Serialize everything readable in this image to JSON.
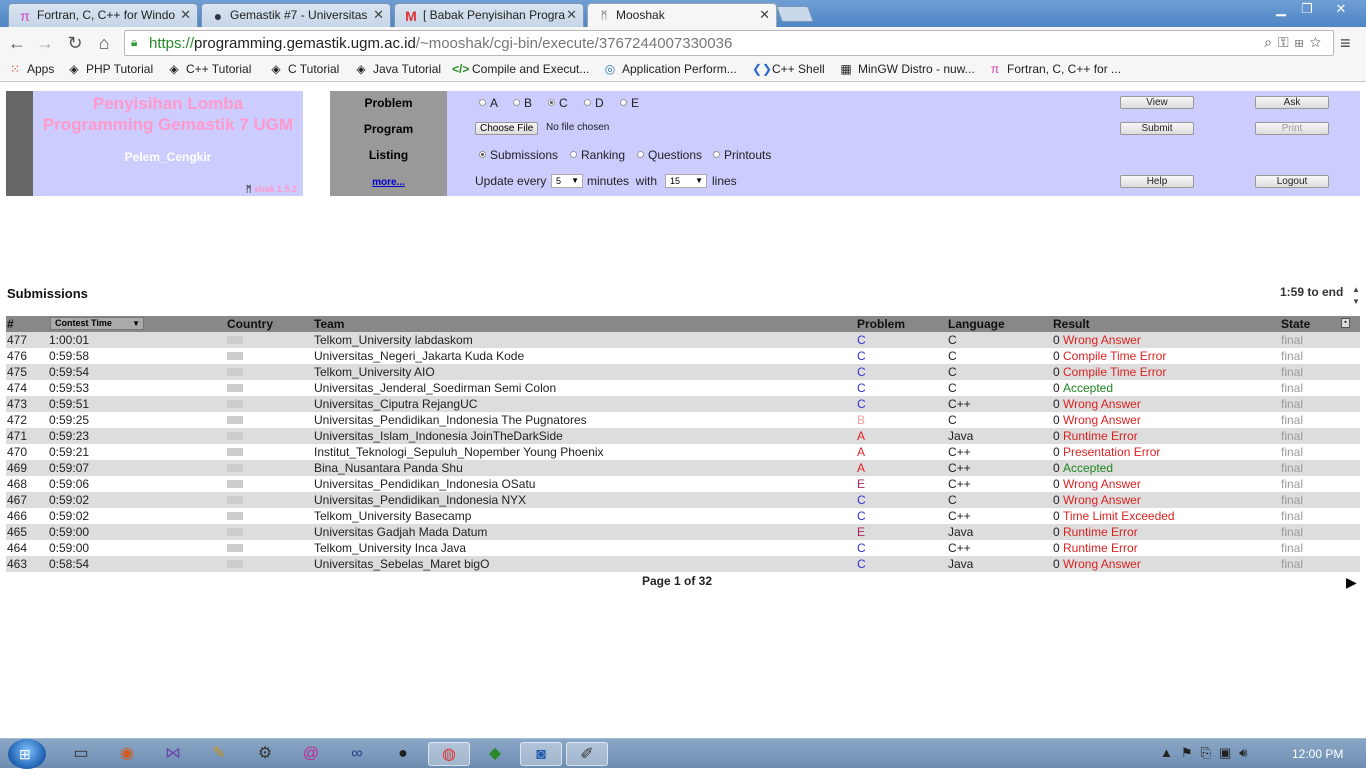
{
  "browser": {
    "tabs": [
      {
        "title": "Fortran, C, C++ for Windo",
        "icon": "pi-icon"
      },
      {
        "title": "Gemastik #7 - Universitas",
        "icon": "globe-icon"
      },
      {
        "title": "[ Babak Penyisihan Progra",
        "icon": "gmail-icon"
      },
      {
        "title": "Mooshak",
        "icon": "mooshak-icon",
        "active": true
      }
    ],
    "url_scheme": "https://",
    "url_host": "programming.gemastik.ugm.ac.id",
    "url_path": "/~mooshak/cgi-bin/execute/3767244007330036",
    "bookmarks": [
      {
        "label": "Apps",
        "icon": "apps-grid-icon"
      },
      {
        "label": "PHP Tutorial",
        "icon": "diamond-icon"
      },
      {
        "label": "C++ Tutorial",
        "icon": "diamond-icon"
      },
      {
        "label": "C Tutorial",
        "icon": "diamond-icon"
      },
      {
        "label": "Java Tutorial",
        "icon": "diamond-icon"
      },
      {
        "label": "Compile and Execut...",
        "icon": "code-icon"
      },
      {
        "label": "Application Perform...",
        "icon": "ring-icon"
      },
      {
        "label": "C++ Shell",
        "icon": "arrows-icon"
      },
      {
        "label": "MinGW Distro - nuw...",
        "icon": "grid-icon"
      },
      {
        "label": "Fortran, C, C++ for ...",
        "icon": "pi-icon"
      }
    ]
  },
  "logo": {
    "title_line1": "Penyisihan Lomba",
    "title_line2": "Programming Gemastik 7 UGM",
    "team": "Pelem_Cengkir",
    "version": "shak 1.5.2"
  },
  "controls": {
    "problem_label": "Problem",
    "program_label": "Program",
    "listing_label": "Listing",
    "more_label": "more...",
    "problems": [
      "A",
      "B",
      "C",
      "D",
      "E"
    ],
    "selected_problem": "C",
    "choose_file": "Choose File",
    "no_file": "No file chosen",
    "listings": [
      "Submissions",
      "Ranking",
      "Questions",
      "Printouts"
    ],
    "selected_listing": "Submissions",
    "update_every": "Update every",
    "update_value": "5",
    "minutes_with": "minutes  with",
    "lines_value": "15",
    "lines": "lines",
    "buttons": {
      "view": "View",
      "ask": "Ask",
      "submit": "Submit",
      "print": "Print",
      "help": "Help",
      "logout": "Logout"
    }
  },
  "submissions": {
    "title": "Submissions",
    "time_to_end": "1:59 to end",
    "columns": [
      "#",
      "Contest Time",
      "Country",
      "Team",
      "Problem",
      "Language",
      "Result",
      "State"
    ],
    "rows": [
      {
        "id": "477",
        "time": "1:00:01",
        "team": "Telkom_University labdaskom",
        "problem": "C",
        "pcolor": "#3333cc",
        "lang": "C",
        "score": "0",
        "result": "Wrong Answer",
        "rcolor": "#dd2222",
        "state": "final"
      },
      {
        "id": "476",
        "time": "0:59:58",
        "team": "Universitas_Negeri_Jakarta Kuda Kode",
        "problem": "C",
        "pcolor": "#3333cc",
        "lang": "C",
        "score": "0",
        "result": "Compile Time Error",
        "rcolor": "#dd2222",
        "state": "final"
      },
      {
        "id": "475",
        "time": "0:59:54",
        "team": "Telkom_University AIO",
        "problem": "C",
        "pcolor": "#3333cc",
        "lang": "C",
        "score": "0",
        "result": "Compile Time Error",
        "rcolor": "#dd2222",
        "state": "final"
      },
      {
        "id": "474",
        "time": "0:59:53",
        "team": "Universitas_Jenderal_Soedirman Semi Colon",
        "problem": "C",
        "pcolor": "#3333cc",
        "lang": "C",
        "score": "0",
        "result": "Accepted",
        "rcolor": "#228822",
        "state": "final"
      },
      {
        "id": "473",
        "time": "0:59:51",
        "team": "Universitas_Ciputra RejangUC",
        "problem": "C",
        "pcolor": "#3333cc",
        "lang": "C++",
        "score": "0",
        "result": "Wrong Answer",
        "rcolor": "#dd2222",
        "state": "final"
      },
      {
        "id": "472",
        "time": "0:59:25",
        "team": "Universitas_Pendidikan_Indonesia The Pugnatores",
        "problem": "B",
        "pcolor": "#f2a0a0",
        "lang": "C",
        "score": "0",
        "result": "Wrong Answer",
        "rcolor": "#dd2222",
        "state": "final"
      },
      {
        "id": "471",
        "time": "0:59:23",
        "team": "Universitas_Islam_Indonesia JoinTheDarkSide",
        "problem": "A",
        "pcolor": "#dd2222",
        "lang": "Java",
        "score": "0",
        "result": "Runtime Error",
        "rcolor": "#dd2222",
        "state": "final"
      },
      {
        "id": "470",
        "time": "0:59:21",
        "team": "Institut_Teknologi_Sepuluh_Nopember Young Phoenix",
        "problem": "A",
        "pcolor": "#dd2222",
        "lang": "C++",
        "score": "0",
        "result": "Presentation Error",
        "rcolor": "#dd2222",
        "state": "final"
      },
      {
        "id": "469",
        "time": "0:59:07",
        "team": "Bina_Nusantara Panda Shu",
        "problem": "A",
        "pcolor": "#dd2222",
        "lang": "C++",
        "score": "0",
        "result": "Accepted",
        "rcolor": "#228822",
        "state": "final"
      },
      {
        "id": "468",
        "time": "0:59:06",
        "team": "Universitas_Pendidikan_Indonesia OSatu",
        "problem": "E",
        "pcolor": "#aa2266",
        "lang": "C++",
        "score": "0",
        "result": "Wrong Answer",
        "rcolor": "#dd2222",
        "state": "final"
      },
      {
        "id": "467",
        "time": "0:59:02",
        "team": "Universitas_Pendidikan_Indonesia NYX",
        "problem": "C",
        "pcolor": "#3333cc",
        "lang": "C",
        "score": "0",
        "result": "Wrong Answer",
        "rcolor": "#dd2222",
        "state": "final"
      },
      {
        "id": "466",
        "time": "0:59:02",
        "team": "Telkom_University Basecamp",
        "problem": "C",
        "pcolor": "#3333cc",
        "lang": "C++",
        "score": "0",
        "result": "Time Limit Exceeded",
        "rcolor": "#dd2222",
        "state": "final"
      },
      {
        "id": "465",
        "time": "0:59:00",
        "team": "Universitas Gadjah Mada Datum",
        "problem": "E",
        "pcolor": "#aa2266",
        "lang": "Java",
        "score": "0",
        "result": "Runtime Error",
        "rcolor": "#dd2222",
        "state": "final"
      },
      {
        "id": "464",
        "time": "0:59:00",
        "team": "Telkom_University Inca Java",
        "problem": "C",
        "pcolor": "#3333cc",
        "lang": "C++",
        "score": "0",
        "result": "Runtime Error",
        "rcolor": "#dd2222",
        "state": "final"
      },
      {
        "id": "463",
        "time": "0:58:54",
        "team": "Universitas_Sebelas_Maret bigO",
        "problem": "C",
        "pcolor": "#3333cc",
        "lang": "Java",
        "score": "0",
        "result": "Wrong Answer",
        "rcolor": "#dd2222",
        "state": "final"
      }
    ],
    "page_info": "Page 1 of 32"
  },
  "taskbar": {
    "clock": "12:00 PM"
  }
}
